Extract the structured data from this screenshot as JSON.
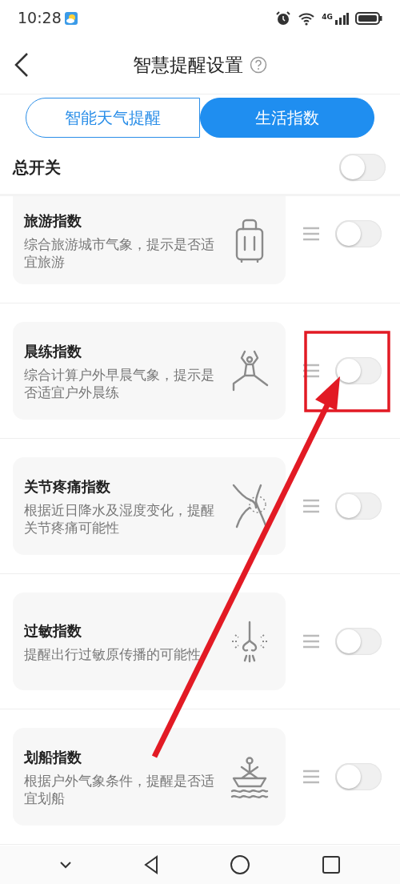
{
  "status_bar": {
    "time": "10:28",
    "network": "4G"
  },
  "header": {
    "title": "智慧提醒设置"
  },
  "tabs": [
    {
      "label": "智能天气提醒",
      "selected": false
    },
    {
      "label": "生活指数",
      "selected": true
    }
  ],
  "master_switch": {
    "label": "总开关",
    "on": false
  },
  "items": [
    {
      "title": "旅游指数",
      "description": "综合旅游城市气象，提示是否适宜旅游",
      "on": false
    },
    {
      "title": "晨练指数",
      "description": "综合计算户外早晨气象，提示是否适宜户外晨练",
      "on": false
    },
    {
      "title": "关节疼痛指数",
      "description": "根据近日降水及湿度变化，提醒关节疼痛可能性",
      "on": false
    },
    {
      "title": "过敏指数",
      "description": "提醒出行过敏原传播的可能性",
      "on": false
    },
    {
      "title": "划船指数",
      "description": "根据户外气象条件，提醒是否适宜划船",
      "on": false
    }
  ]
}
